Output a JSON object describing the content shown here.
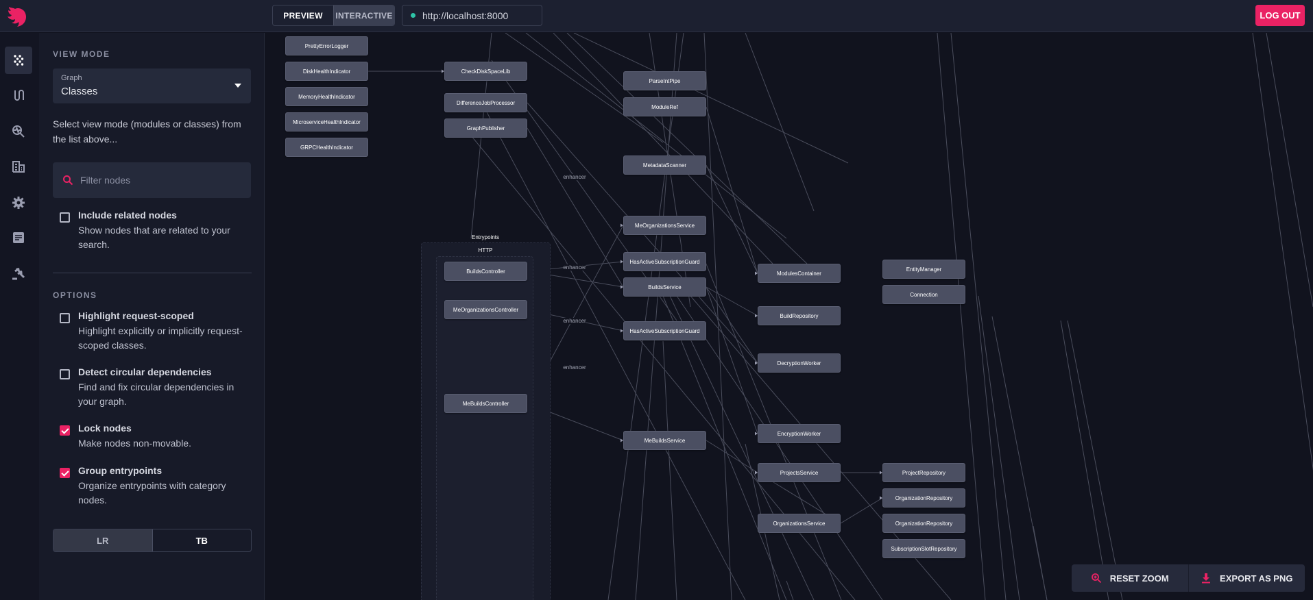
{
  "colors": {
    "accent": "#ea2264",
    "node": "#4b4f62",
    "canvas": "#11131e",
    "status": "#2ec4a7"
  },
  "header": {
    "preview_label": "PREVIEW",
    "interactive_label": "INTERACTIVE",
    "url": "http://localhost:8000",
    "logout_label": "LOG OUT"
  },
  "rail": {
    "icons": [
      "graph-icon",
      "routes-icon",
      "inspect-icon",
      "modules-icon",
      "settings-icon",
      "docs-icon",
      "hammer-icon"
    ]
  },
  "sidebar": {
    "view_mode_title": "VIEW MODE",
    "select_label": "Graph",
    "select_value": "Classes",
    "description": "Select view mode (modules or classes) from the list above...",
    "filter_placeholder": "Filter nodes",
    "include_related": {
      "title": "Include related nodes",
      "desc": "Show nodes that are related to your search.",
      "checked": false
    },
    "options_title": "OPTIONS",
    "options": [
      {
        "title": "Highlight request-scoped",
        "desc": "Highlight explicitly or implicitly request-scoped classes.",
        "checked": false
      },
      {
        "title": "Detect circular dependencies",
        "desc": "Find and fix circular dependencies in your graph.",
        "checked": false
      },
      {
        "title": "Lock nodes",
        "desc": "Make nodes non-movable.",
        "checked": true
      },
      {
        "title": "Group entrypoints",
        "desc": "Organize entrypoints with category nodes.",
        "checked": true
      }
    ],
    "direction": {
      "lr": "LR",
      "tb": "TB",
      "selected": "LR"
    }
  },
  "graph": {
    "group_label": "Entrypoints",
    "subgroup_label": "HTTP",
    "edge_label": "enhancer",
    "nodes": [
      "PrettyErrorLogger",
      "DiskHealthIndicator",
      "MemoryHealthIndicator",
      "MicroserviceHealthIndicator",
      "GRPCHealthIndicator",
      "CheckDiskSpaceLib",
      "DifferenceJobProcessor",
      "GraphPublisher",
      "ParseIntPipe",
      "ModuleRef",
      "MetadataScanner",
      "MeOrganizationsService",
      "HasActiveSubscriptionGuard",
      "BuildsService",
      "HasActiveSubscriptionGuard",
      "MeBuildsService",
      "BuildsController",
      "MeOrganizationsController",
      "MeBuildsController",
      "ModulesContainer",
      "BuildRepository",
      "DecryptionWorker",
      "EncryptionWorker",
      "ProjectsService",
      "OrganizationsService",
      "EntityManager",
      "Connection",
      "ProjectRepository",
      "OrganizationRepository",
      "OrganizationRepository",
      "SubscriptionSlotRepository"
    ],
    "edges": [
      [
        1,
        5
      ],
      [
        16,
        12
      ],
      [
        16,
        13
      ],
      [
        17,
        14
      ],
      [
        18,
        11
      ],
      [
        18,
        15
      ],
      [
        7,
        13
      ],
      [
        13,
        20
      ],
      [
        13,
        21
      ],
      [
        13,
        22
      ],
      [
        15,
        23
      ],
      [
        23,
        27
      ],
      [
        24,
        28
      ],
      [
        24,
        23
      ],
      [
        6,
        21
      ],
      [
        9,
        19
      ],
      [
        10,
        19
      ]
    ]
  },
  "actions": {
    "reset_zoom": "RESET ZOOM",
    "export_png": "EXPORT AS PNG"
  }
}
